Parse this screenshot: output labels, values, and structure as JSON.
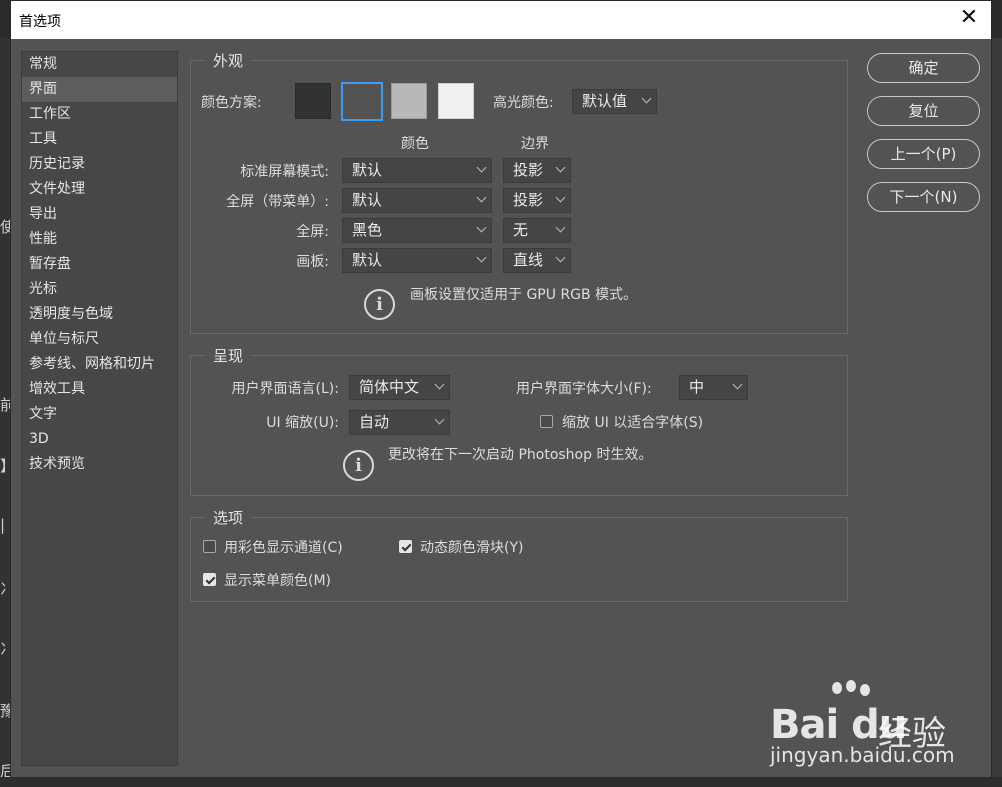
{
  "dialog": {
    "title": "首选项",
    "close_glyph": "✕"
  },
  "background_glyphs": [
    "使",
    "前",
    "】",
    "|",
    "冫",
    "冫",
    "豫",
    "后"
  ],
  "sidebar": {
    "items": [
      {
        "label": "常规",
        "active": false
      },
      {
        "label": "界面",
        "active": true
      },
      {
        "label": "工作区",
        "active": false
      },
      {
        "label": "工具",
        "active": false
      },
      {
        "label": "历史记录",
        "active": false
      },
      {
        "label": "文件处理",
        "active": false
      },
      {
        "label": "导出",
        "active": false
      },
      {
        "label": "性能",
        "active": false
      },
      {
        "label": "暂存盘",
        "active": false
      },
      {
        "label": "光标",
        "active": false
      },
      {
        "label": "透明度与色域",
        "active": false
      },
      {
        "label": "单位与标尺",
        "active": false
      },
      {
        "label": "参考线、网格和切片",
        "active": false
      },
      {
        "label": "增效工具",
        "active": false
      },
      {
        "label": "文字",
        "active": false
      },
      {
        "label": "3D",
        "active": false
      },
      {
        "label": "技术预览",
        "active": false
      }
    ]
  },
  "appearance": {
    "title": "外观",
    "color_scheme_label": "颜色方案:",
    "swatches": [
      {
        "color": "#323232",
        "selected": false
      },
      {
        "color": "#535353",
        "selected": true
      },
      {
        "color": "#b8b8b8",
        "selected": false
      },
      {
        "color": "#f0f0f0",
        "selected": false
      }
    ],
    "highlight_label": "高光颜色:",
    "highlight_value": "默认值",
    "col_color": "颜色",
    "col_border": "边界",
    "rows": [
      {
        "label": "标准屏幕模式:",
        "color": "默认",
        "border": "投影"
      },
      {
        "label": "全屏（带菜单）:",
        "color": "默认",
        "border": "投影"
      },
      {
        "label": "全屏:",
        "color": "黑色",
        "border": "无"
      },
      {
        "label": "画板:",
        "color": "默认",
        "border": "直线"
      }
    ],
    "info_text": "画板设置仅适用于 GPU RGB 模式。"
  },
  "presentation": {
    "title": "呈现",
    "lang_label": "用户界面语言(L):",
    "lang_value": "简体中文",
    "font_size_label": "用户界面字体大小(F):",
    "font_size_value": "中",
    "ui_scale_label": "UI 缩放(U):",
    "ui_scale_value": "自动",
    "scale_to_font_label": "缩放 UI 以适合字体(S)",
    "scale_to_font_checked": false,
    "info_text": "更改将在下一次启动 Photoshop 时生效。"
  },
  "options": {
    "title": "选项",
    "items": [
      {
        "label": "用彩色显示通道(C)",
        "checked": false
      },
      {
        "label": "动态颜色滑块(Y)",
        "checked": true
      },
      {
        "label": "显示菜单颜色(M)",
        "checked": true
      }
    ]
  },
  "buttons": {
    "ok": "确定",
    "reset": "复位",
    "prev": "上一个(P)",
    "next": "下一个(N)"
  },
  "watermark": {
    "logo": "Bai du",
    "suffix": "经验",
    "url": "jingyan.baidu.com"
  }
}
